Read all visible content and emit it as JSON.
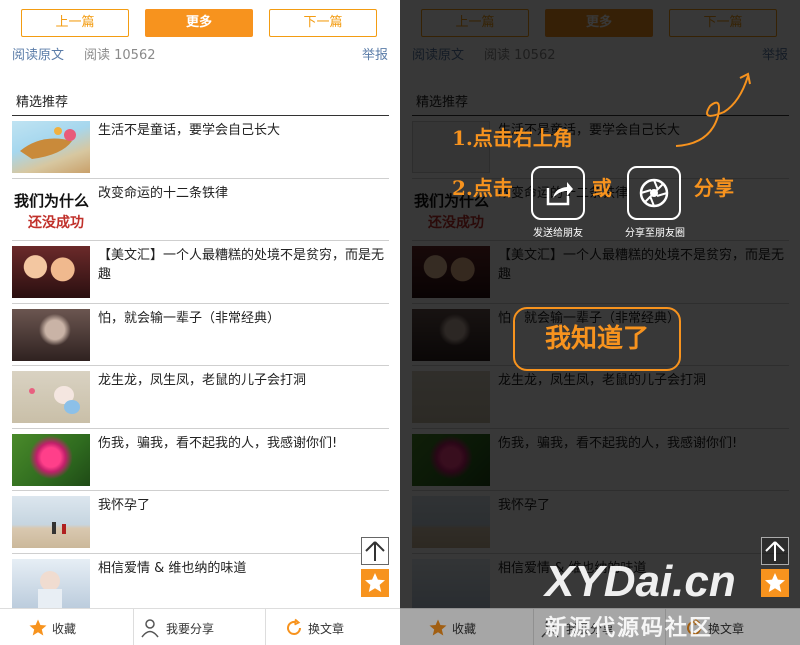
{
  "nav": {
    "prev_label": "上一篇",
    "more_label": "更多",
    "next_label": "下一篇"
  },
  "meta": {
    "original_label": "阅读原文",
    "reads_label": "阅读 10562",
    "report_label": "举报"
  },
  "section_title": "精选推荐",
  "articles": [
    {
      "title": "生活不是童话，要学会自己长大"
    },
    {
      "title": "改变命运的十二条铁律"
    },
    {
      "title": "【美文汇】一个人最糟糕的处境不是贫穷，而是无趣"
    },
    {
      "title": "怕，就会输一辈子（非常经典）"
    },
    {
      "title": "龙生龙，凤生凤，老鼠的儿子会打洞"
    },
    {
      "title": "伤我，骗我，看不起我的人，我感谢你们!"
    },
    {
      "title": "我怀孕了"
    },
    {
      "title": "相信爱情 & 维也纳的味道"
    }
  ],
  "thumb_text": {
    "t1_big": "我们为什么",
    "t1_small": "还没成功"
  },
  "bottom_bar": {
    "favorite_label": "收藏",
    "share_label": "我要分享",
    "switch_label": "换文章"
  },
  "overlay": {
    "step1": "1.点击右上角",
    "step2_prefix": "2.点击",
    "step2_or": "或",
    "step2_suffix": "分享",
    "send_friend_label": "发送给朋友",
    "moments_label": "分享至朋友圈",
    "got_it_label": "我知道了"
  },
  "watermark": {
    "main": "XYDai.cn",
    "sub": "新源代源码社区"
  },
  "colors": {
    "accent": "#f7931e",
    "link": "#5a7ca8",
    "overlay": "#000000"
  },
  "icons": [
    "star-icon",
    "user-icon",
    "refresh-icon",
    "arrow-up-icon",
    "share-icon",
    "aperture-icon"
  ]
}
